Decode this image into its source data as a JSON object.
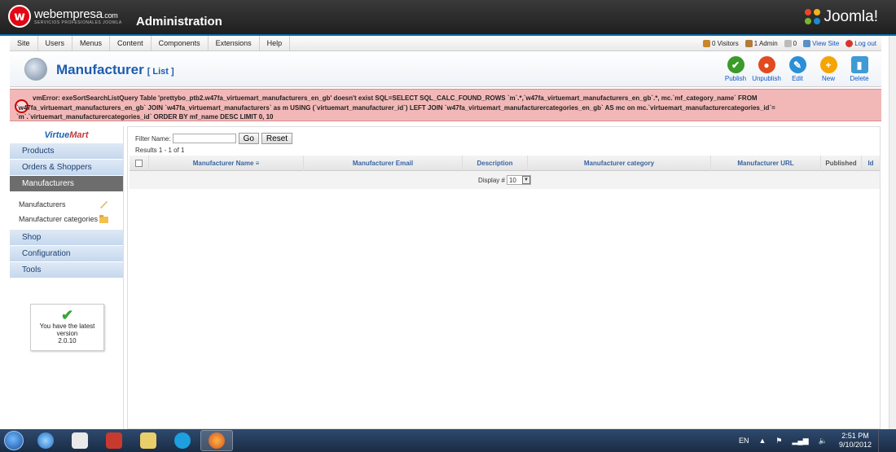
{
  "header": {
    "logo_initial": "w",
    "logo_name": "webempresa",
    "logo_suffix": ".com",
    "logo_tagline": "SERVICIOS PROFESIONALES JOOMLA",
    "title": "Administration",
    "brand": "Joomla!"
  },
  "menubar": {
    "items": [
      "Site",
      "Users",
      "Menus",
      "Content",
      "Components",
      "Extensions",
      "Help"
    ],
    "visitors": "0 Visitors",
    "admins": "1 Admin",
    "messages": "0",
    "view_site": "View Site",
    "logout": "Log out"
  },
  "toolbar": {
    "title": "Manufacturer",
    "subtitle": "[ List ]",
    "buttons": [
      {
        "label": "Publish",
        "icon": "check-icon",
        "color": "#3a9a2a"
      },
      {
        "label": "Unpublish",
        "icon": "stop-icon",
        "color": "#e24a1f"
      },
      {
        "label": "Edit",
        "icon": "pencil-icon",
        "color": "#2a8fd6"
      },
      {
        "label": "New",
        "icon": "plus-icon",
        "color": "#f5a400"
      },
      {
        "label": "Delete",
        "icon": "trash-icon",
        "color": "#3f9ad6"
      }
    ]
  },
  "error": {
    "message": "vmError: exeSortSearchListQuery Table 'prettybo_ptb2.w47fa_virtuemart_manufacturers_en_gb' doesn't exist SQL=SELECT SQL_CALC_FOUND_ROWS `m`.*,`w47fa_virtuemart_manufacturers_en_gb`.*, mc.`mf_category_name` FROM `w47fa_virtuemart_manufacturers_en_gb` JOIN `w47fa_virtuemart_manufacturers` as m USING (`virtuemart_manufacturer_id`) LEFT JOIN `w47fa_virtuemart_manufacturercategories_en_gb` AS mc on mc.`virtuemart_manufacturercategories_id`= `m`.`virtuemart_manufacturercategories_id` ORDER BY mf_name DESC LIMIT 0, 10"
  },
  "sidebar": {
    "logo_a": "Virtue",
    "logo_b": "Mart",
    "items_top": [
      "Products",
      "Orders & Shoppers"
    ],
    "active": "Manufacturers",
    "subitems": [
      "Manufacturers",
      "Manufacturer categories"
    ],
    "items_bottom": [
      "Shop",
      "Configuration",
      "Tools"
    ],
    "version_line1": "You have the latest version",
    "version_number": "2.0.10"
  },
  "main": {
    "filter_label": "Filter Name:",
    "filter_value": "",
    "go_label": "Go",
    "reset_label": "Reset",
    "results": "Results 1 - 1 of 1",
    "columns": [
      "Manufacturer Name",
      "Manufacturer Email",
      "Description",
      "Manufacturer category",
      "Manufacturer URL",
      "Published",
      "Id"
    ],
    "display_label": "Display #",
    "display_value": "10"
  },
  "taskbar": {
    "lang": "EN",
    "time": "2:51 PM",
    "date": "9/10/2012"
  }
}
